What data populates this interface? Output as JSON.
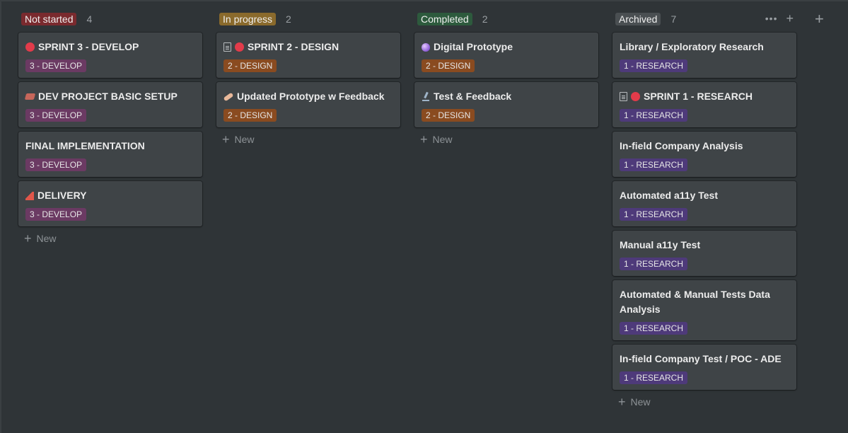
{
  "columns": [
    {
      "status": "Not started",
      "count": "4",
      "color": "#7a2a2e",
      "new_label": "New",
      "cards": [
        {
          "title": "SPRINT 3 - DEVELOP",
          "icons": [
            "red-circle"
          ],
          "tag": "3 - DEVELOP",
          "tag_class": "develop"
        },
        {
          "title": "DEV PROJECT BASIC SETUP",
          "icons": [
            "brick"
          ],
          "tag": "3 - DEVELOP",
          "tag_class": "develop"
        },
        {
          "title": "FINAL IMPLEMENTATION",
          "icons": [],
          "tag": "3 - DEVELOP",
          "tag_class": "develop"
        },
        {
          "title": "DELIVERY",
          "icons": [
            "party-popper"
          ],
          "tag": "3 - DEVELOP",
          "tag_class": "develop"
        }
      ]
    },
    {
      "status": "In progress",
      "count": "2",
      "color": "#8a6a2c",
      "new_label": "New",
      "cards": [
        {
          "title": "SPRINT 2 - DESIGN",
          "icons": [
            "document",
            "red-circle"
          ],
          "tag": "2 - DESIGN",
          "tag_class": "design"
        },
        {
          "title": "Updated Prototype w Feedback",
          "icons": [
            "adhesive-bandage"
          ],
          "tag": "2 - DESIGN",
          "tag_class": "design"
        }
      ]
    },
    {
      "status": "Completed",
      "count": "2",
      "color": "#2d5a3d",
      "new_label": "New",
      "cards": [
        {
          "title": "Digital Prototype",
          "icons": [
            "crystal-ball"
          ],
          "tag": "2 - DESIGN",
          "tag_class": "design"
        },
        {
          "title": "Test & Feedback",
          "icons": [
            "microscope"
          ],
          "tag": "2 - DESIGN",
          "tag_class": "design"
        }
      ]
    },
    {
      "status": "Archived",
      "count": "7",
      "color": "#4a4f52",
      "new_label": "New",
      "cards": [
        {
          "title": "Library / Exploratory Research",
          "icons": [],
          "tag": "1 - RESEARCH",
          "tag_class": "research"
        },
        {
          "title": "SPRINT 1 - RESEARCH",
          "icons": [
            "document",
            "red-circle"
          ],
          "tag": "1 - RESEARCH",
          "tag_class": "research"
        },
        {
          "title": "In-field Company Analysis",
          "icons": [],
          "tag": "1 - RESEARCH",
          "tag_class": "research"
        },
        {
          "title": "Automated a11y Test",
          "icons": [],
          "tag": "1 - RESEARCH",
          "tag_class": "research"
        },
        {
          "title": "Manual a11y Test",
          "icons": [],
          "tag": "1 - RESEARCH",
          "tag_class": "research"
        },
        {
          "title": "Automated & Manual Tests Data Analysis",
          "icons": [],
          "tag": "1 - RESEARCH",
          "tag_class": "research"
        },
        {
          "title": "In-field Company Test / POC - ADE",
          "icons": [],
          "tag": "1 - RESEARCH",
          "tag_class": "research"
        }
      ]
    }
  ],
  "icons": {
    "more": "more-horizontal-icon",
    "plus": "plus-icon",
    "dots_glyph": "•••",
    "plus_glyph": "+"
  },
  "colors": {
    "background": "#2f3437",
    "card": "#3f4447",
    "tag_develop": "#6b3a63",
    "tag_design": "#8a4b20",
    "tag_research": "#4e3a7a"
  }
}
